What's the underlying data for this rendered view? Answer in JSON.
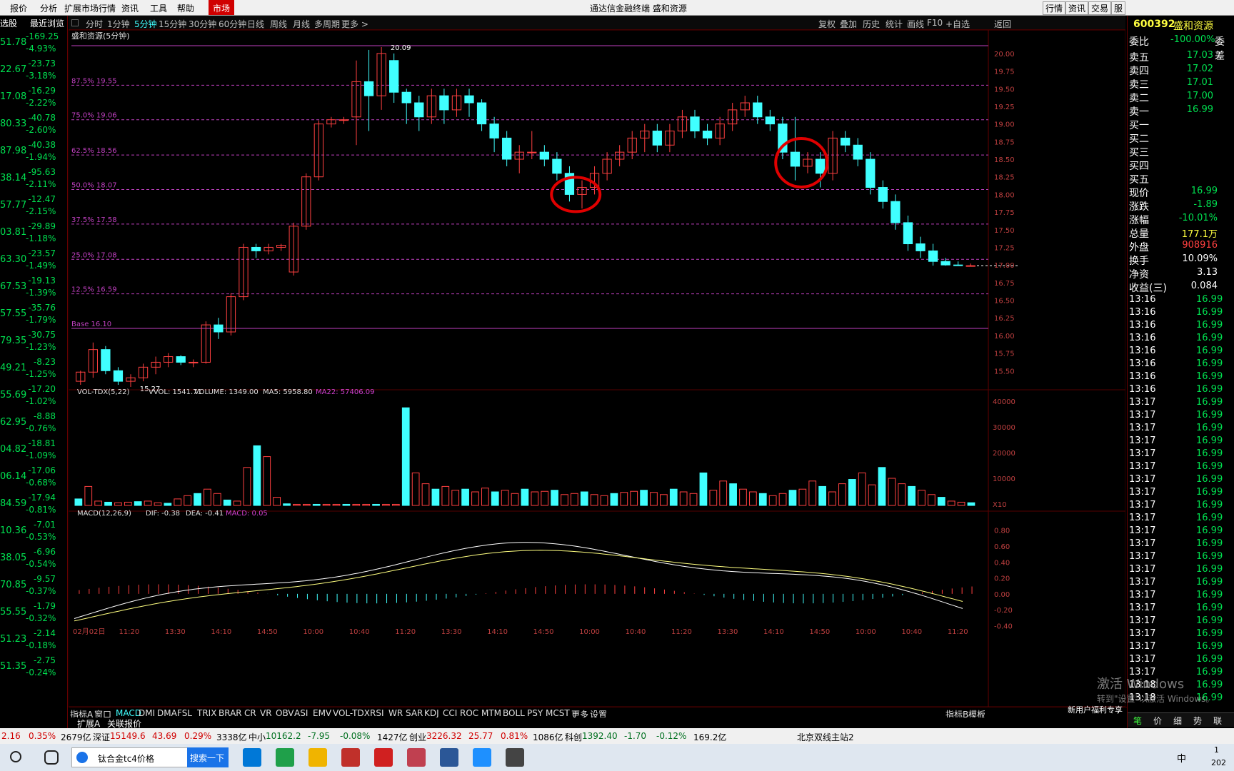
{
  "menubar": {
    "items": [
      "报价",
      "分析",
      "扩展市场行情",
      "资讯",
      "工具",
      "帮助",
      "市场"
    ],
    "title": "通达信金融终端  盛和资源",
    "right_buttons": [
      "行情",
      "资讯",
      "交易",
      "服"
    ]
  },
  "left_panel": {
    "headers": [
      "选股",
      "最近浏览"
    ],
    "rows": [
      {
        "price": "51.78",
        "chg": "-169.25",
        "pct": "-4.93%"
      },
      {
        "price": "22.67",
        "chg": "-23.73",
        "pct": "-3.18%"
      },
      {
        "price": "17.08",
        "chg": "-16.29",
        "pct": "-2.22%"
      },
      {
        "price": "80.33",
        "chg": "-40.78",
        "pct": "-2.60%"
      },
      {
        "price": "87.98",
        "chg": "-40.38",
        "pct": "-1.94%"
      },
      {
        "price": "38.14",
        "chg": "-95.63",
        "pct": "-2.11%"
      },
      {
        "price": "57.77",
        "chg": "-12.47",
        "pct": "-2.15%"
      },
      {
        "price": "03.81",
        "chg": "-29.89",
        "pct": "-1.18%"
      },
      {
        "price": "63.30",
        "chg": "-23.57",
        "pct": "-1.49%"
      },
      {
        "price": "67.53",
        "chg": "-19.13",
        "pct": "-1.39%"
      },
      {
        "price": "57.55",
        "chg": "-35.76",
        "pct": "-1.79%"
      },
      {
        "price": "79.35",
        "chg": "-30.75",
        "pct": "-1.23%"
      },
      {
        "price": "49.21",
        "chg": "-8.23",
        "pct": "-1.25%"
      },
      {
        "price": "55.69",
        "chg": "-17.20",
        "pct": "-1.02%"
      },
      {
        "price": "62.95",
        "chg": "-8.88",
        "pct": "-0.76%"
      },
      {
        "price": "04.82",
        "chg": "-18.81",
        "pct": "-1.09%"
      },
      {
        "price": "06.14",
        "chg": "-17.06",
        "pct": "-0.68%"
      },
      {
        "price": "84.59",
        "chg": "-17.94",
        "pct": "-0.81%"
      },
      {
        "price": "10.36",
        "chg": "-7.01",
        "pct": "-0.53%"
      },
      {
        "price": "38.05",
        "chg": "-6.96",
        "pct": "-0.54%"
      },
      {
        "price": "70.85",
        "chg": "-9.57",
        "pct": "-0.37%"
      },
      {
        "price": "55.55",
        "chg": "-1.79",
        "pct": "-0.32%"
      },
      {
        "price": "51.23",
        "chg": "-2.14",
        "pct": "-0.18%"
      },
      {
        "price": "51.35",
        "chg": "-2.75",
        "pct": "-0.24%"
      }
    ]
  },
  "chart_header": {
    "periods": [
      "分时",
      "1分钟",
      "5分钟",
      "15分钟",
      "30分钟",
      "60分钟",
      "日线",
      "周线",
      "月线",
      "多周期",
      "更多 >"
    ],
    "active": "5分钟",
    "tools": [
      "复权",
      "叠加",
      "历史",
      "统计",
      "画线",
      "F10",
      "+自选",
      "返回"
    ],
    "title": "盛和资源(5分钟)"
  },
  "fib_labels": [
    "87.5% 19.55",
    "75.0% 19.06",
    "62.5% 18.56",
    "50.0% 18.07",
    "37.5% 17.58",
    "25.0% 17.08",
    "12.5% 16.59",
    "Base 16.10"
  ],
  "high_label": "20.09",
  "low_label": "15.27",
  "price_axis": [
    "20.00",
    "19.75",
    "19.50",
    "19.25",
    "19.00",
    "18.75",
    "18.50",
    "18.25",
    "18.00",
    "17.75",
    "17.50",
    "17.25",
    "17.00",
    "16.75",
    "16.50",
    "16.25",
    "16.00",
    "15.75",
    "15.50"
  ],
  "vol_header": {
    "name": "VOL-TDX(5,22)",
    "vvol": "VVOL: 1541.71",
    "volume": "VOLUME: 1349.00",
    "ma5": "MA5: 5958.80",
    "ma22": "MA22: 57406.09"
  },
  "vol_axis": [
    "40000",
    "30000",
    "20000",
    "10000",
    "X10"
  ],
  "macd_header": {
    "name": "MACD(12,26,9)",
    "dif": "DIF: -0.38",
    "dea": "DEA: -0.41",
    "macd": "MACD: 0.05"
  },
  "macd_axis": [
    "0.80",
    "0.60",
    "0.40",
    "0.20",
    "0.00",
    "-0.20",
    "-0.40"
  ],
  "time_axis": [
    "02月02日",
    "11:20",
    "13:30",
    "14:10",
    "14:50",
    "10:00",
    "10:40",
    "11:20",
    "13:30",
    "14:10",
    "14:50",
    "10:00",
    "10:40",
    "11:20",
    "13:30",
    "14:10",
    "14:50",
    "10:00",
    "10:40",
    "11:20"
  ],
  "indicator_tabs": [
    "指标A",
    "窗口",
    "MACD",
    "DMI",
    "DMA",
    "FSL",
    "TRIX",
    "BRAR",
    "CR",
    "VR",
    "OBV",
    "ASI",
    "EMV",
    "VOL-TDX",
    "RSI",
    "WR",
    "SAR",
    "KDJ",
    "CCI",
    "ROC",
    "MTM",
    "BOLL",
    "PSY",
    "MCST",
    "更多",
    "设置"
  ],
  "indicator_right": [
    "指标B",
    "模板"
  ],
  "sub_tabs": [
    "扩展A",
    "关联报价"
  ],
  "right_panel": {
    "code": "600392",
    "name": "盛和资源",
    "weibi_label": "委比",
    "weibi": "-100.00%",
    "weicha": "委差",
    "asks": [
      {
        "l": "卖五",
        "p": "17.03"
      },
      {
        "l": "卖四",
        "p": "17.02"
      },
      {
        "l": "卖三",
        "p": "17.01"
      },
      {
        "l": "卖二",
        "p": "17.00"
      },
      {
        "l": "卖一",
        "p": "16.99"
      }
    ],
    "bids": [
      "买一",
      "买二",
      "买三",
      "买四",
      "买五"
    ],
    "stats": [
      {
        "l": "现价",
        "v": "16.99",
        "c": "green"
      },
      {
        "l": "涨跌",
        "v": "-1.89",
        "c": "green"
      },
      {
        "l": "涨幅",
        "v": "-10.01%",
        "c": "green"
      },
      {
        "l": "总量",
        "v": "177.1万",
        "c": "yellow"
      },
      {
        "l": "外盘",
        "v": "908916",
        "c": "red"
      },
      {
        "l": "换手",
        "v": "10.09%",
        "c": "white"
      },
      {
        "l": "净资",
        "v": "3.13",
        "c": "white"
      },
      {
        "l": "收益(三)",
        "v": "0.084",
        "c": "white"
      }
    ],
    "ticks": [
      "13:16",
      "13:16",
      "13:16",
      "13:16",
      "13:16",
      "13:16",
      "13:16",
      "13:16",
      "13:17",
      "13:17",
      "13:17",
      "13:17",
      "13:17",
      "13:17",
      "13:17",
      "13:17",
      "13:17",
      "13:17",
      "13:17",
      "13:17",
      "13:17",
      "13:17",
      "13:17",
      "13:17",
      "13:17",
      "13:17",
      "13:17",
      "13:17",
      "13:17",
      "13:17",
      "13:18",
      "13:18",
      "13:18",
      "13:18",
      "13:18",
      "13:18",
      "13:18",
      "13:18"
    ],
    "tick_price": "16.99",
    "bottom_tabs": [
      "笔",
      "价",
      "细",
      "势",
      "联"
    ],
    "promo": "新用户福利专享"
  },
  "watermark": {
    "line1": "激活 Windows",
    "line2": "转到\"设置\"以激活 Windows。"
  },
  "status_bar": {
    "items": [
      {
        "t": "2.16",
        "c": "red"
      },
      {
        "t": "0.35%",
        "c": "red"
      },
      {
        "t": "2679亿",
        "c": "black"
      },
      {
        "t": "深证",
        "c": "black"
      },
      {
        "t": "15149.6",
        "c": "red"
      },
      {
        "t": "43.69",
        "c": "red"
      },
      {
        "t": "0.29%",
        "c": "red"
      },
      {
        "t": "3338亿",
        "c": "black"
      },
      {
        "t": "中小",
        "c": "black"
      },
      {
        "t": "10162.2",
        "c": "green"
      },
      {
        "t": "-7.95",
        "c": "green"
      },
      {
        "t": "-0.08%",
        "c": "green"
      },
      {
        "t": "1427亿",
        "c": "black"
      },
      {
        "t": "创业",
        "c": "black"
      },
      {
        "t": "3226.32",
        "c": "red"
      },
      {
        "t": "25.77",
        "c": "red"
      },
      {
        "t": "0.81%",
        "c": "red"
      },
      {
        "t": "1086亿",
        "c": "black"
      },
      {
        "t": "科创",
        "c": "black"
      },
      {
        "t": "1392.40",
        "c": "green"
      },
      {
        "t": "-1.70",
        "c": "green"
      },
      {
        "t": "-0.12%",
        "c": "green"
      },
      {
        "t": "169.2亿",
        "c": "black"
      }
    ],
    "server": "北京双线主站2"
  },
  "taskbar": {
    "search_text": "钛合金tc4价格",
    "search_button": "搜索一下",
    "tray_lang": "中",
    "clock_top": "1",
    "clock_bottom": "202"
  },
  "chart_data": {
    "type": "candlestick",
    "title": "盛和资源(5分钟)",
    "high": 20.09,
    "low": 15.27,
    "ylim": [
      15.27,
      20.09
    ],
    "fib_levels": [
      {
        "label": "87.5%",
        "value": 19.55
      },
      {
        "label": "75.0%",
        "value": 19.06
      },
      {
        "label": "62.5%",
        "value": 18.56
      },
      {
        "label": "50.0%",
        "value": 18.07
      },
      {
        "label": "37.5%",
        "value": 17.58
      },
      {
        "label": "25.0%",
        "value": 17.08
      },
      {
        "label": "12.5%",
        "value": 16.59
      },
      {
        "label": "Base",
        "value": 16.1
      }
    ],
    "candles": [
      [
        15.35,
        15.5,
        15.3,
        15.48
      ],
      [
        15.48,
        15.9,
        15.4,
        15.8
      ],
      [
        15.8,
        15.85,
        15.45,
        15.5
      ],
      [
        15.5,
        15.55,
        15.3,
        15.35
      ],
      [
        15.35,
        15.45,
        15.27,
        15.4
      ],
      [
        15.4,
        15.6,
        15.35,
        15.55
      ],
      [
        15.55,
        15.7,
        15.45,
        15.62
      ],
      [
        15.62,
        15.75,
        15.55,
        15.7
      ],
      [
        15.7,
        15.72,
        15.58,
        15.62
      ],
      [
        15.62,
        15.66,
        15.55,
        15.62
      ],
      [
        15.62,
        16.2,
        15.6,
        16.15
      ],
      [
        16.15,
        16.25,
        15.95,
        16.05
      ],
      [
        16.05,
        16.6,
        16.0,
        16.55
      ],
      [
        16.55,
        17.3,
        16.5,
        17.25
      ],
      [
        17.25,
        17.3,
        17.1,
        17.2
      ],
      [
        17.2,
        17.3,
        17.15,
        17.25
      ],
      [
        17.25,
        17.3,
        17.2,
        17.28
      ],
      [
        16.9,
        17.6,
        16.85,
        17.55
      ],
      [
        17.55,
        18.3,
        17.5,
        18.25
      ],
      [
        18.25,
        19.05,
        18.2,
        19.0
      ],
      [
        19.0,
        19.1,
        18.95,
        19.06
      ],
      [
        19.06,
        19.1,
        19.0,
        19.06
      ],
      [
        19.1,
        19.9,
        18.7,
        19.6
      ],
      [
        19.6,
        20.05,
        18.9,
        19.4
      ],
      [
        19.4,
        20.09,
        19.2,
        20.0
      ],
      [
        19.9,
        20.0,
        19.3,
        19.45
      ],
      [
        19.45,
        19.5,
        19.0,
        19.3
      ],
      [
        19.3,
        19.4,
        18.9,
        19.1
      ],
      [
        19.1,
        19.5,
        19.0,
        19.4
      ],
      [
        19.4,
        19.5,
        19.0,
        19.2
      ],
      [
        19.2,
        19.5,
        19.1,
        19.4
      ],
      [
        19.4,
        19.5,
        19.1,
        19.3
      ],
      [
        19.3,
        19.35,
        18.9,
        19.0
      ],
      [
        19.0,
        19.1,
        18.6,
        18.8
      ],
      [
        18.8,
        18.9,
        18.4,
        18.5
      ],
      [
        18.5,
        18.7,
        18.3,
        18.6
      ],
      [
        18.6,
        18.9,
        18.5,
        18.6
      ],
      [
        18.6,
        18.7,
        18.4,
        18.5
      ],
      [
        18.5,
        18.6,
        18.2,
        18.3
      ],
      [
        18.3,
        18.4,
        17.9,
        18.0
      ],
      [
        18.0,
        18.2,
        17.8,
        18.1
      ],
      [
        18.1,
        18.4,
        18.0,
        18.3
      ],
      [
        18.3,
        18.6,
        18.2,
        18.5
      ],
      [
        18.5,
        18.7,
        18.4,
        18.6
      ],
      [
        18.6,
        18.9,
        18.5,
        18.8
      ],
      [
        18.8,
        19.0,
        18.6,
        18.9
      ],
      [
        18.9,
        19.0,
        18.6,
        18.7
      ],
      [
        18.7,
        19.0,
        18.6,
        18.9
      ],
      [
        18.9,
        19.2,
        18.8,
        19.1
      ],
      [
        19.1,
        19.2,
        18.8,
        18.9
      ],
      [
        18.9,
        19.0,
        18.7,
        18.8
      ],
      [
        18.8,
        19.1,
        18.7,
        19.0
      ],
      [
        19.0,
        19.3,
        18.9,
        19.2
      ],
      [
        19.2,
        19.4,
        19.1,
        19.3
      ],
      [
        19.3,
        19.4,
        19.0,
        19.1
      ],
      [
        19.1,
        19.2,
        18.9,
        19.0
      ],
      [
        19.0,
        19.1,
        18.5,
        18.6
      ],
      [
        18.6,
        19.1,
        18.2,
        18.4
      ],
      [
        18.4,
        18.6,
        18.3,
        18.5
      ],
      [
        18.5,
        18.6,
        18.1,
        18.3
      ],
      [
        18.3,
        18.9,
        18.2,
        18.8
      ],
      [
        18.8,
        18.9,
        18.6,
        18.7
      ],
      [
        18.7,
        18.8,
        18.4,
        18.5
      ],
      [
        18.5,
        18.6,
        18.0,
        18.1
      ],
      [
        18.1,
        18.2,
        17.8,
        17.9
      ],
      [
        17.9,
        18.0,
        17.5,
        17.6
      ],
      [
        17.6,
        17.7,
        17.2,
        17.3
      ],
      [
        17.3,
        17.4,
        17.1,
        17.2
      ],
      [
        17.2,
        17.3,
        16.99,
        17.05
      ],
      [
        17.05,
        17.1,
        16.99,
        17.0
      ],
      [
        17.0,
        17.05,
        16.99,
        16.99
      ],
      [
        16.99,
        17.02,
        16.99,
        16.99
      ]
    ],
    "volume": [
      12,
      35,
      8,
      6,
      5,
      6,
      7,
      8,
      5,
      4,
      12,
      18,
      22,
      30,
      22,
      10,
      8,
      70,
      110,
      90,
      15,
      3,
      2,
      2,
      2,
      2,
      2,
      2,
      2,
      2,
      2,
      2,
      2,
      180,
      60,
      40,
      30,
      35,
      28,
      30,
      25,
      32,
      25,
      28,
      22,
      30,
      25,
      26,
      28,
      20,
      22,
      25,
      20,
      18,
      22,
      24,
      26,
      28,
      24,
      20,
      30,
      25,
      22,
      60,
      28,
      45,
      40,
      30,
      25,
      22,
      18,
      22,
      28,
      30,
      45,
      35,
      25,
      40,
      48,
      60,
      38,
      70,
      50,
      40,
      35,
      28,
      20,
      15,
      8,
      6,
      5
    ],
    "volume_ymax": 200,
    "macd_ylim": [
      -0.45,
      0.95
    ]
  }
}
